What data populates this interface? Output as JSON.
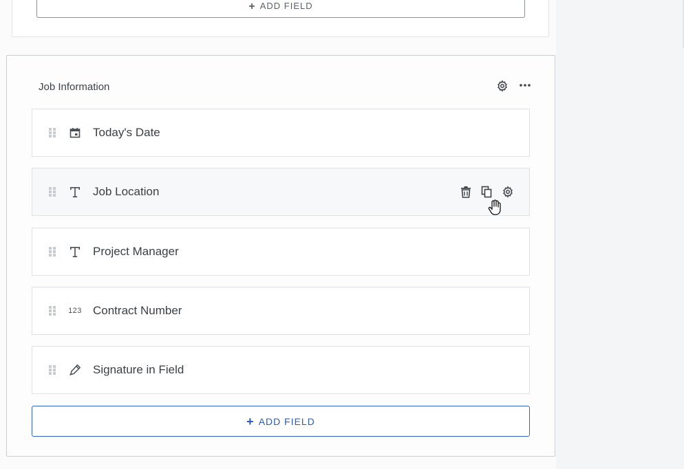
{
  "prev_section": {
    "add_field_label": "ADD FIELD"
  },
  "section": {
    "title": "Job Information",
    "fields": [
      {
        "label": "Today's Date",
        "type_icon": "calendar-icon"
      },
      {
        "label": "Job Location",
        "type_icon": "text-type-icon"
      },
      {
        "label": "Project Manager",
        "type_icon": "text-type-icon"
      },
      {
        "label": "Contract Number",
        "type_icon": "number-type-icon",
        "type_text": "123"
      },
      {
        "label": "Signature in Field",
        "type_icon": "pen-icon"
      }
    ],
    "add_field_label": "ADD FIELD"
  },
  "colors": {
    "accent": "#2a5cc0",
    "border": "#c9ccd1"
  }
}
